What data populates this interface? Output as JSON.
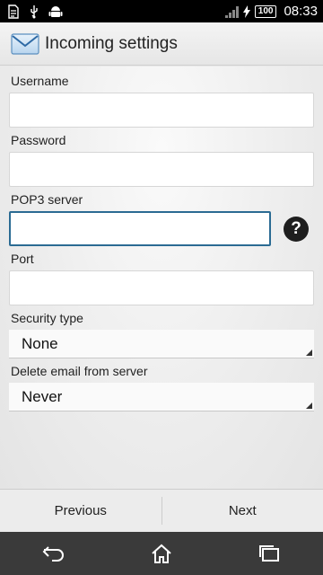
{
  "status_bar": {
    "icons": [
      "edit-note-icon",
      "usb-icon",
      "android-icon"
    ],
    "right_icons": [
      "signal-icon",
      "charging-icon"
    ],
    "battery": "100",
    "time": "08:33"
  },
  "action_bar": {
    "icon": "email-envelope-icon",
    "title": "Incoming settings"
  },
  "form": {
    "username_label": "Username",
    "username_value": "",
    "password_label": "Password",
    "password_value": "",
    "pop3_label": "POP3 server",
    "pop3_value": "",
    "help_icon": "help-icon",
    "help_glyph": "?",
    "port_label": "Port",
    "port_value": "",
    "security_label": "Security type",
    "security_value": "None",
    "delete_label": "Delete email from server",
    "delete_value": "Never"
  },
  "buttons": {
    "previous": "Previous",
    "next": "Next"
  },
  "nav_bar": {
    "icons": [
      "back-icon",
      "home-icon",
      "recent-apps-icon"
    ]
  }
}
